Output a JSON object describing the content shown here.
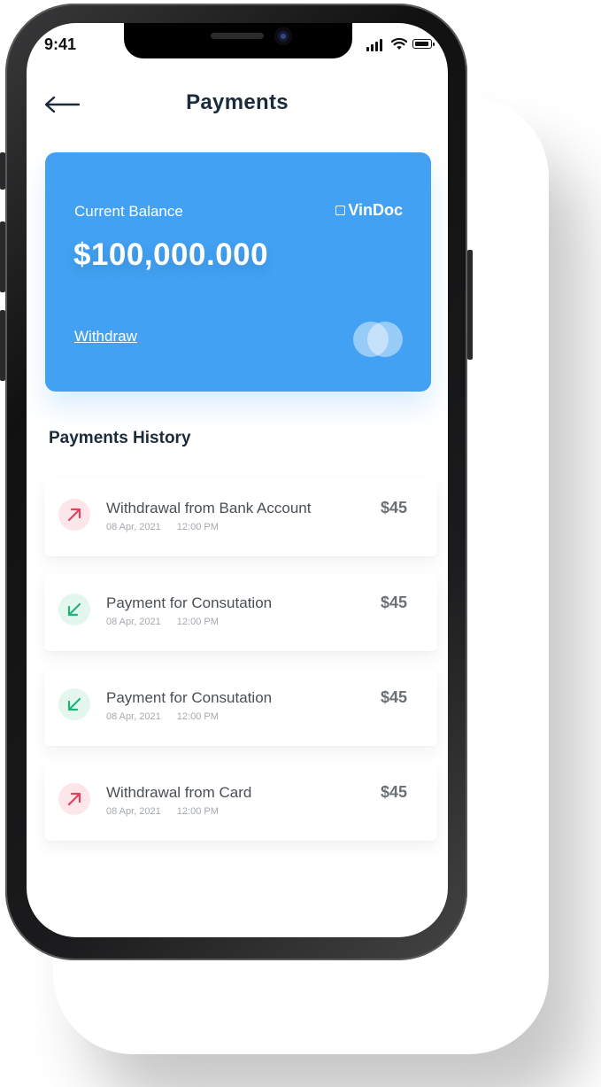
{
  "status_bar": {
    "time": "9:41"
  },
  "header": {
    "title": "Payments"
  },
  "balance_card": {
    "label": "Current Balance",
    "brand": "VinDoc",
    "amount": "$100,000.000",
    "withdraw_label": "Withdraw",
    "color": "#42a1f3"
  },
  "history": {
    "title": "Payments History",
    "items": [
      {
        "title": "Withdrawal from Bank Account",
        "date": "08 Apr, 2021",
        "time": "12:00 PM",
        "amount": "$45",
        "direction": "out"
      },
      {
        "title": "Payment for Consutation",
        "date": "08 Apr, 2021",
        "time": "12:00 PM",
        "amount": "$45",
        "direction": "in"
      },
      {
        "title": "Payment for Consutation",
        "date": "08 Apr, 2021",
        "time": "12:00 PM",
        "amount": "$45",
        "direction": "in"
      },
      {
        "title": "Withdrawal from Card",
        "date": "08 Apr, 2021",
        "time": "12:00 PM",
        "amount": "$45",
        "direction": "out"
      }
    ]
  },
  "colors": {
    "outgoing": "#e5405e",
    "incoming": "#21b27a",
    "title": "#1b2b3a"
  },
  "icons": {
    "back": "arrow-left-icon",
    "outgoing": "arrow-up-right-icon",
    "incoming": "arrow-down-left-icon"
  }
}
